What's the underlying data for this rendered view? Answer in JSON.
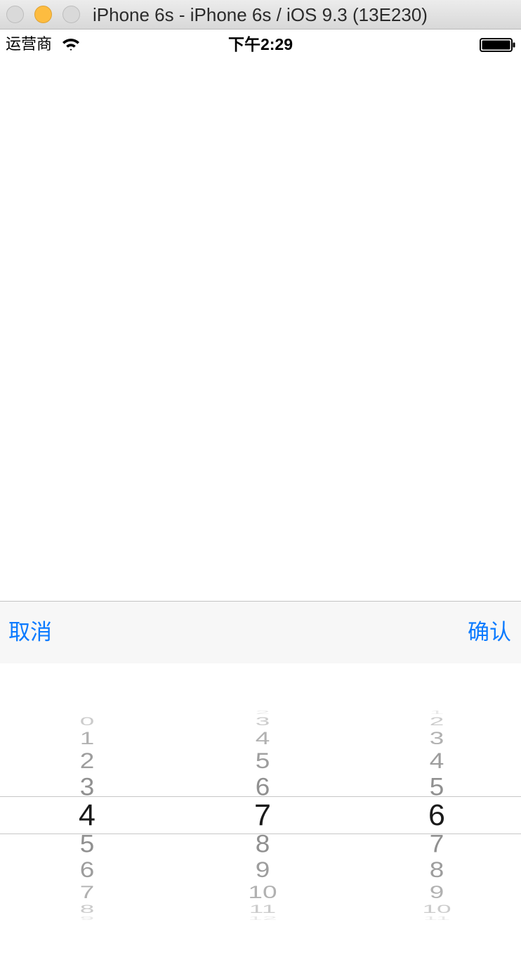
{
  "window": {
    "title": "iPhone 6s - iPhone 6s / iOS 9.3 (13E230)"
  },
  "status_bar": {
    "carrier": "运营商",
    "time": "下午2:29"
  },
  "toolbar": {
    "cancel_label": "取消",
    "confirm_label": "确认",
    "button_color": "#0a7aff"
  },
  "picker": {
    "columns": [
      {
        "name": "first",
        "selected": "4",
        "rows": [
          "0",
          "1",
          "2",
          "3",
          "4",
          "5",
          "6",
          "7",
          "8",
          "9"
        ]
      },
      {
        "name": "second",
        "selected": "7",
        "rows": [
          "2",
          "3",
          "4",
          "5",
          "6",
          "7",
          "8",
          "9",
          "10",
          "11",
          "12"
        ]
      },
      {
        "name": "third",
        "selected": "6",
        "rows": [
          "1",
          "2",
          "3",
          "4",
          "5",
          "6",
          "7",
          "8",
          "9",
          "10",
          "11"
        ]
      }
    ]
  }
}
